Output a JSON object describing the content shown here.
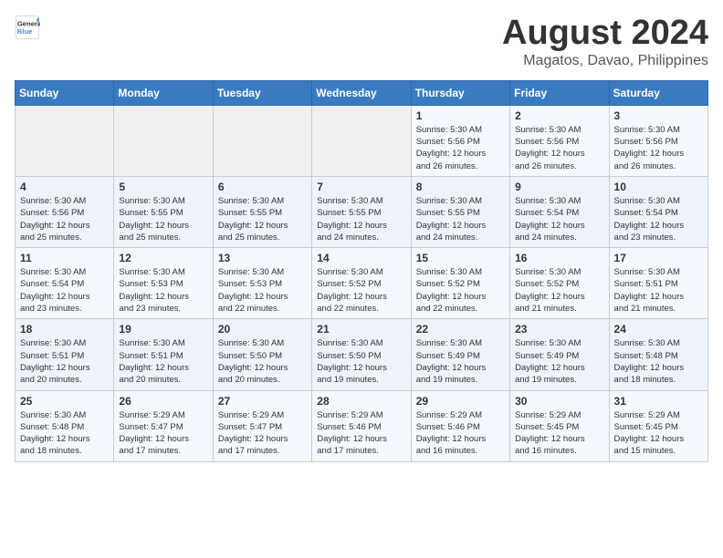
{
  "header": {
    "logo": {
      "general": "General",
      "blue": "Blue"
    },
    "title": "August 2024",
    "subtitle": "Magatos, Davao, Philippines"
  },
  "weekdays": [
    "Sunday",
    "Monday",
    "Tuesday",
    "Wednesday",
    "Thursday",
    "Friday",
    "Saturday"
  ],
  "weeks": [
    [
      {
        "day": "",
        "info": ""
      },
      {
        "day": "",
        "info": ""
      },
      {
        "day": "",
        "info": ""
      },
      {
        "day": "",
        "info": ""
      },
      {
        "day": "1",
        "info": "Sunrise: 5:30 AM\nSunset: 5:56 PM\nDaylight: 12 hours\nand 26 minutes."
      },
      {
        "day": "2",
        "info": "Sunrise: 5:30 AM\nSunset: 5:56 PM\nDaylight: 12 hours\nand 26 minutes."
      },
      {
        "day": "3",
        "info": "Sunrise: 5:30 AM\nSunset: 5:56 PM\nDaylight: 12 hours\nand 26 minutes."
      }
    ],
    [
      {
        "day": "4",
        "info": "Sunrise: 5:30 AM\nSunset: 5:56 PM\nDaylight: 12 hours\nand 25 minutes."
      },
      {
        "day": "5",
        "info": "Sunrise: 5:30 AM\nSunset: 5:55 PM\nDaylight: 12 hours\nand 25 minutes."
      },
      {
        "day": "6",
        "info": "Sunrise: 5:30 AM\nSunset: 5:55 PM\nDaylight: 12 hours\nand 25 minutes."
      },
      {
        "day": "7",
        "info": "Sunrise: 5:30 AM\nSunset: 5:55 PM\nDaylight: 12 hours\nand 24 minutes."
      },
      {
        "day": "8",
        "info": "Sunrise: 5:30 AM\nSunset: 5:55 PM\nDaylight: 12 hours\nand 24 minutes."
      },
      {
        "day": "9",
        "info": "Sunrise: 5:30 AM\nSunset: 5:54 PM\nDaylight: 12 hours\nand 24 minutes."
      },
      {
        "day": "10",
        "info": "Sunrise: 5:30 AM\nSunset: 5:54 PM\nDaylight: 12 hours\nand 23 minutes."
      }
    ],
    [
      {
        "day": "11",
        "info": "Sunrise: 5:30 AM\nSunset: 5:54 PM\nDaylight: 12 hours\nand 23 minutes."
      },
      {
        "day": "12",
        "info": "Sunrise: 5:30 AM\nSunset: 5:53 PM\nDaylight: 12 hours\nand 23 minutes."
      },
      {
        "day": "13",
        "info": "Sunrise: 5:30 AM\nSunset: 5:53 PM\nDaylight: 12 hours\nand 22 minutes."
      },
      {
        "day": "14",
        "info": "Sunrise: 5:30 AM\nSunset: 5:52 PM\nDaylight: 12 hours\nand 22 minutes."
      },
      {
        "day": "15",
        "info": "Sunrise: 5:30 AM\nSunset: 5:52 PM\nDaylight: 12 hours\nand 22 minutes."
      },
      {
        "day": "16",
        "info": "Sunrise: 5:30 AM\nSunset: 5:52 PM\nDaylight: 12 hours\nand 21 minutes."
      },
      {
        "day": "17",
        "info": "Sunrise: 5:30 AM\nSunset: 5:51 PM\nDaylight: 12 hours\nand 21 minutes."
      }
    ],
    [
      {
        "day": "18",
        "info": "Sunrise: 5:30 AM\nSunset: 5:51 PM\nDaylight: 12 hours\nand 20 minutes."
      },
      {
        "day": "19",
        "info": "Sunrise: 5:30 AM\nSunset: 5:51 PM\nDaylight: 12 hours\nand 20 minutes."
      },
      {
        "day": "20",
        "info": "Sunrise: 5:30 AM\nSunset: 5:50 PM\nDaylight: 12 hours\nand 20 minutes."
      },
      {
        "day": "21",
        "info": "Sunrise: 5:30 AM\nSunset: 5:50 PM\nDaylight: 12 hours\nand 19 minutes."
      },
      {
        "day": "22",
        "info": "Sunrise: 5:30 AM\nSunset: 5:49 PM\nDaylight: 12 hours\nand 19 minutes."
      },
      {
        "day": "23",
        "info": "Sunrise: 5:30 AM\nSunset: 5:49 PM\nDaylight: 12 hours\nand 19 minutes."
      },
      {
        "day": "24",
        "info": "Sunrise: 5:30 AM\nSunset: 5:48 PM\nDaylight: 12 hours\nand 18 minutes."
      }
    ],
    [
      {
        "day": "25",
        "info": "Sunrise: 5:30 AM\nSunset: 5:48 PM\nDaylight: 12 hours\nand 18 minutes."
      },
      {
        "day": "26",
        "info": "Sunrise: 5:29 AM\nSunset: 5:47 PM\nDaylight: 12 hours\nand 17 minutes."
      },
      {
        "day": "27",
        "info": "Sunrise: 5:29 AM\nSunset: 5:47 PM\nDaylight: 12 hours\nand 17 minutes."
      },
      {
        "day": "28",
        "info": "Sunrise: 5:29 AM\nSunset: 5:46 PM\nDaylight: 12 hours\nand 17 minutes."
      },
      {
        "day": "29",
        "info": "Sunrise: 5:29 AM\nSunset: 5:46 PM\nDaylight: 12 hours\nand 16 minutes."
      },
      {
        "day": "30",
        "info": "Sunrise: 5:29 AM\nSunset: 5:45 PM\nDaylight: 12 hours\nand 16 minutes."
      },
      {
        "day": "31",
        "info": "Sunrise: 5:29 AM\nSunset: 5:45 PM\nDaylight: 12 hours\nand 15 minutes."
      }
    ]
  ]
}
